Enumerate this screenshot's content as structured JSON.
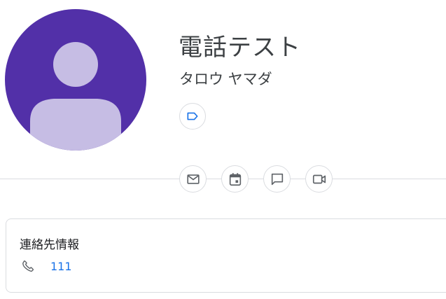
{
  "contact": {
    "name": "電話テスト",
    "phonetic_name": "タロウ ヤマダ"
  },
  "icons": {
    "avatar": "person-silhouette",
    "label": "label-icon",
    "email": "mail-icon",
    "schedule": "calendar-event-icon",
    "chat": "chat-bubble-icon",
    "video": "videocam-icon",
    "phone": "phone-icon"
  },
  "colors": {
    "avatar_bg": "#5230a8",
    "avatar_figure": "#c6bde4",
    "label_icon": "#1a73e8",
    "action_icon": "#5f6368",
    "link": "#1a73e8"
  },
  "contact_info": {
    "title": "連絡先情報",
    "phone": "111"
  }
}
